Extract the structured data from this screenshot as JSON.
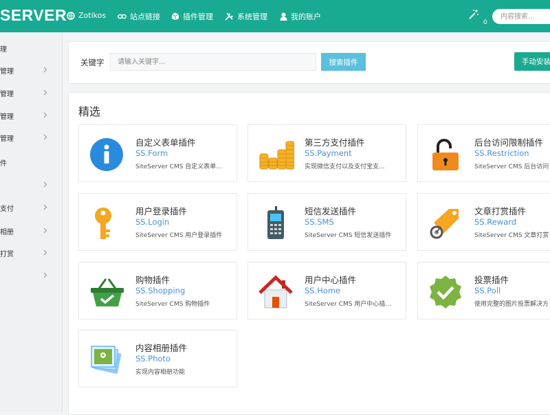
{
  "header": {
    "logo": "SERVER",
    "nav": [
      {
        "label": "Zotikos",
        "icon": "globe-icon"
      },
      {
        "label": "站点链接",
        "icon": "link-icon"
      },
      {
        "label": "插件管理",
        "icon": "cube-icon"
      },
      {
        "label": "系统管理",
        "icon": "tools-icon"
      },
      {
        "label": "我的账户",
        "icon": "user-icon"
      }
    ],
    "notify_count": "0",
    "search_placeholder": "内容搜索..."
  },
  "sidebar": {
    "items": [
      {
        "label": "理"
      },
      {
        "label": "管理"
      },
      {
        "label": "管理"
      },
      {
        "label": "管理"
      },
      {
        "label": "管理"
      },
      {
        "label": "件"
      },
      {
        "label": ""
      },
      {
        "label": "支付"
      },
      {
        "label": "相册"
      },
      {
        "label": "打赏"
      },
      {
        "label": ""
      }
    ]
  },
  "search": {
    "label": "关键字",
    "placeholder": "请输入关键字...",
    "search_button": "搜索插件",
    "manual_button": "手动安装插件"
  },
  "featured": {
    "title": "精选",
    "plugins": [
      {
        "title": "自定义表单插件",
        "code": "SS.Form",
        "desc": "SiteServer CMS 自定义表单...",
        "icon": "info-icon"
      },
      {
        "title": "第三方支付插件",
        "code": "SS.Payment",
        "desc": "实现微信支付以及支付宝支...",
        "icon": "coins-icon"
      },
      {
        "title": "后台访问限制插件",
        "code": "SS.Restriction",
        "desc": "SiteServer CMS 后台访问",
        "icon": "padlock-icon"
      },
      {
        "title": "用户登录插件",
        "code": "SS.Login",
        "desc": "SiteServer CMS 用户登录插件",
        "icon": "key-icon"
      },
      {
        "title": "短信发送插件",
        "code": "SS.SMS",
        "desc": "SiteServer CMS 短信发送插件",
        "icon": "phone-icon"
      },
      {
        "title": "文章打赏插件",
        "code": "SS.Reward",
        "desc": "SiteServer CMS 文章打赏",
        "icon": "price-tag-icon"
      },
      {
        "title": "购物插件",
        "code": "SS.Shopping",
        "desc": "SiteServer CMS 购物插件",
        "icon": "basket-icon"
      },
      {
        "title": "用户中心插件",
        "code": "SS.Home",
        "desc": "SiteServer CMS 用户中心插...",
        "icon": "house-icon"
      },
      {
        "title": "投票插件",
        "code": "SS.Poll",
        "desc": "使用完整的图片投票解决方",
        "icon": "check-badge-icon"
      },
      {
        "title": "内容相册插件",
        "code": "SS.Photo",
        "desc": "实现内容相册功能",
        "icon": "photos-icon"
      }
    ]
  },
  "colors": {
    "brand": "#18aa92",
    "accent_button": "#5bc0de",
    "link": "#4a90d9"
  }
}
